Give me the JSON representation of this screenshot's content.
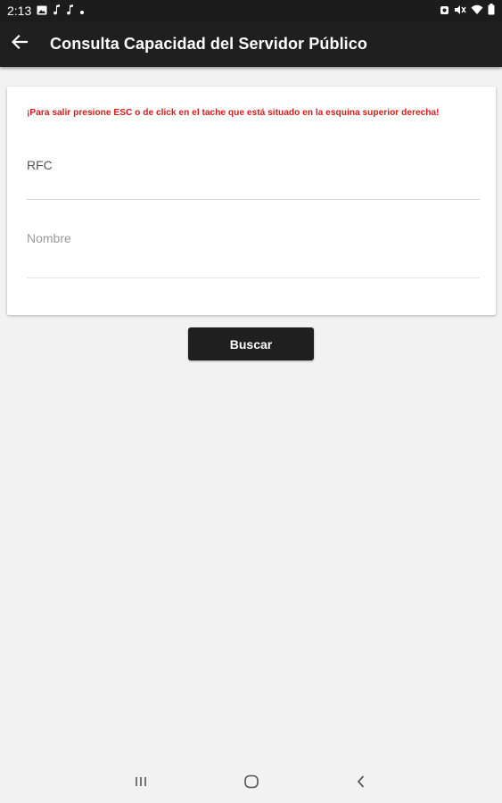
{
  "status_bar": {
    "time": "2:13",
    "left_icons": [
      "image-icon",
      "music-note-icon",
      "music-note-icon",
      "dot-icon"
    ],
    "right_icons": [
      "alarm-icon",
      "mute-icon",
      "wifi-icon",
      "battery-icon"
    ]
  },
  "app_bar": {
    "title": "Consulta Capacidad del Servidor Público",
    "back_icon": "arrow-left-icon"
  },
  "form": {
    "warning": "¡Para salir presione ESC o de click en el tache que está situado en la esquina superior derecha!",
    "rfc_label": "RFC",
    "nombre_placeholder": "Nombre"
  },
  "search_button": {
    "label": "Buscar"
  },
  "nav_bar": {
    "icons": [
      "recent-apps-icon",
      "home-icon",
      "back-icon"
    ]
  },
  "colors": {
    "app_bar": "#1f1f1f",
    "warning_text": "#d81b1b",
    "background": "#f2f2f2",
    "card": "#ffffff"
  }
}
